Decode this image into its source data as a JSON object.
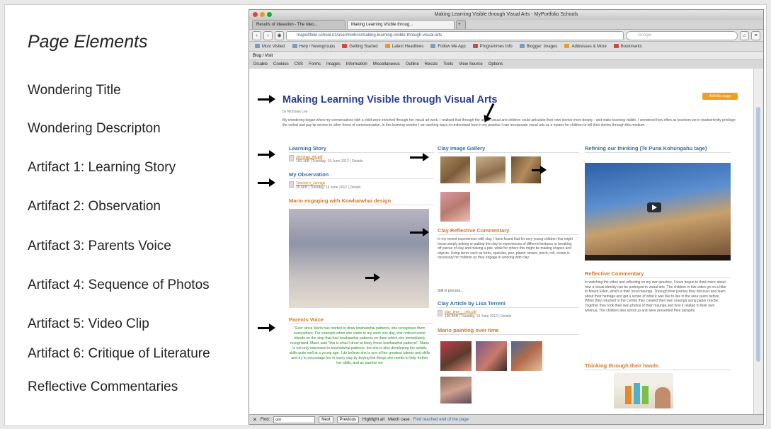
{
  "legend": {
    "title": "Page Elements",
    "items": [
      "Wondering Title",
      "Wondering Descripton",
      "Artifact 1: Learning Story",
      "Artifact 2: Observation",
      "Artifact 3: Parents Voice",
      "Artifact 4: Sequence of Photos",
      "Artifact 5: Video Clip",
      "Artifact 6: Critique of Literature",
      "Reflective Commentaries"
    ]
  },
  "browser": {
    "window_title": "Making Learning Visible through Visual Arts - MyPortfolio Schools",
    "tabs": [
      "Results of Ideastion - The Ideo...",
      "Making Learning Visible throug..."
    ],
    "url": "mapo4folio.school.nz/user/minhos/making-learning-visible-through-visual-arts",
    "search_placeholder": "Google",
    "bookmarks": [
      "Most Visited",
      "Help / Newsgroups",
      "Getting Started",
      "Latest Headlines",
      "Follow Me App",
      "Programmes Info",
      "Blogger: Images",
      "Addresses & More",
      "Bookmarks"
    ],
    "wordpress": "Blog / Visit",
    "devtools": [
      "Disable",
      "Cookies",
      "CSS",
      "Forms",
      "Images",
      "Information",
      "Miscellaneous",
      "Outline",
      "Resize",
      "Tools",
      "View Source",
      "Options"
    ],
    "find": {
      "label": "Find:",
      "value": "gas",
      "next": "Next",
      "previous": "Previous",
      "highlight": "Highlight all",
      "match_case": "Match case",
      "status": "Find reached end of the page"
    }
  },
  "page": {
    "title": "Making Learning Visible through Visual Arts",
    "byline": "by Nicholas Lee",
    "share_button": "Add this page",
    "description": "My wondering began when my conversations with a child were enriched through her visual art work. I realised that through the use of visual arts children could articulate their own stories more deeply - and make learning visible. I wondered how often as teachers we in inadvertently privilege the verbal and pay lip service to other forms of communication. In this learning wonder I am seeking ways to understand how in my practice I can incorporate visual arts as a means for children to tell their stories through this medium.",
    "learning_story": {
      "heading": "Learning Story",
      "file": "Jennings_ink.pdf",
      "meta": "160.1KB | Tuesday, 19 June 2012 | Details"
    },
    "observation": {
      "heading": "My Observation",
      "file": "Teacher's_Jennigs",
      "meta": "35.6KB | Tuesday, 19 June 2012 | Details"
    },
    "kowhaiwhai_heading": "Mario engaging with Kowhaiwhai design",
    "parents_voice": {
      "heading": "Parents Voice",
      "text": "\"Ever since Mario has started to draw kowhaiwhai patterns, she recognises them everywhere. For example when she came to my work one day, she noticed some blends on the step that had kowhaiwhai patterns on them which she immediately recognised. Mario said \"this is what I drew at kindy those kowhaiwhai patterns\". Mario is not only interested in kowhaiwhai patterns, but she is also developing her artistic skills quite well at a young age. I do believe she is one of her greatest talents and skills and try to encourage her in every way by buying the things she needs to help further her skills, and as parents we"
    },
    "clay_gallery": {
      "heading": "Clay Image Gallery"
    },
    "clay_commentary": {
      "heading": "Clay Reflective Commentary",
      "text": "In my recent experiences with clay, I have found that for very young children this might mean simply poking or patting the clay to experiences of different textures or breaking off pieces of clay and making a pile, while for others this might be making shapes and objects. Using items such as forks, spatulas, pen, plastic straws, pinch, roll, create is necessary for children as they engage in working with clay.",
      "more": "Still in process..."
    },
    "clay_article": {
      "heading": "Clay Article by Lisa Terreni",
      "file": "clay_time_-_info.pdf",
      "meta": "190.8KB | Tuesday, 19 June 2012 | Details"
    },
    "painting_heading": "Mario painting over time",
    "refining": {
      "heading": "Refining our thinking (Te Puna Kohungahu tage)"
    },
    "reflective_commentary": {
      "heading": "Reflective Commentary",
      "text": "In watching the video and reflecting on my own practice, I have begun to think more about how a visual identity can be portrayed in visual arts. The children in this video go on a hike to Mount Eden, which is their local maunga. Through their journey they discover and learn about their heritage and get a sense of what it was like to live in the area years before. When they returned to the Centre they created their own maunga using paper mache. Together they took their own photos of their maunga and how it related to their own whenua. The children also stood up and were presented their paraphs."
    },
    "thinking_heading": "Thinking through their hands"
  }
}
